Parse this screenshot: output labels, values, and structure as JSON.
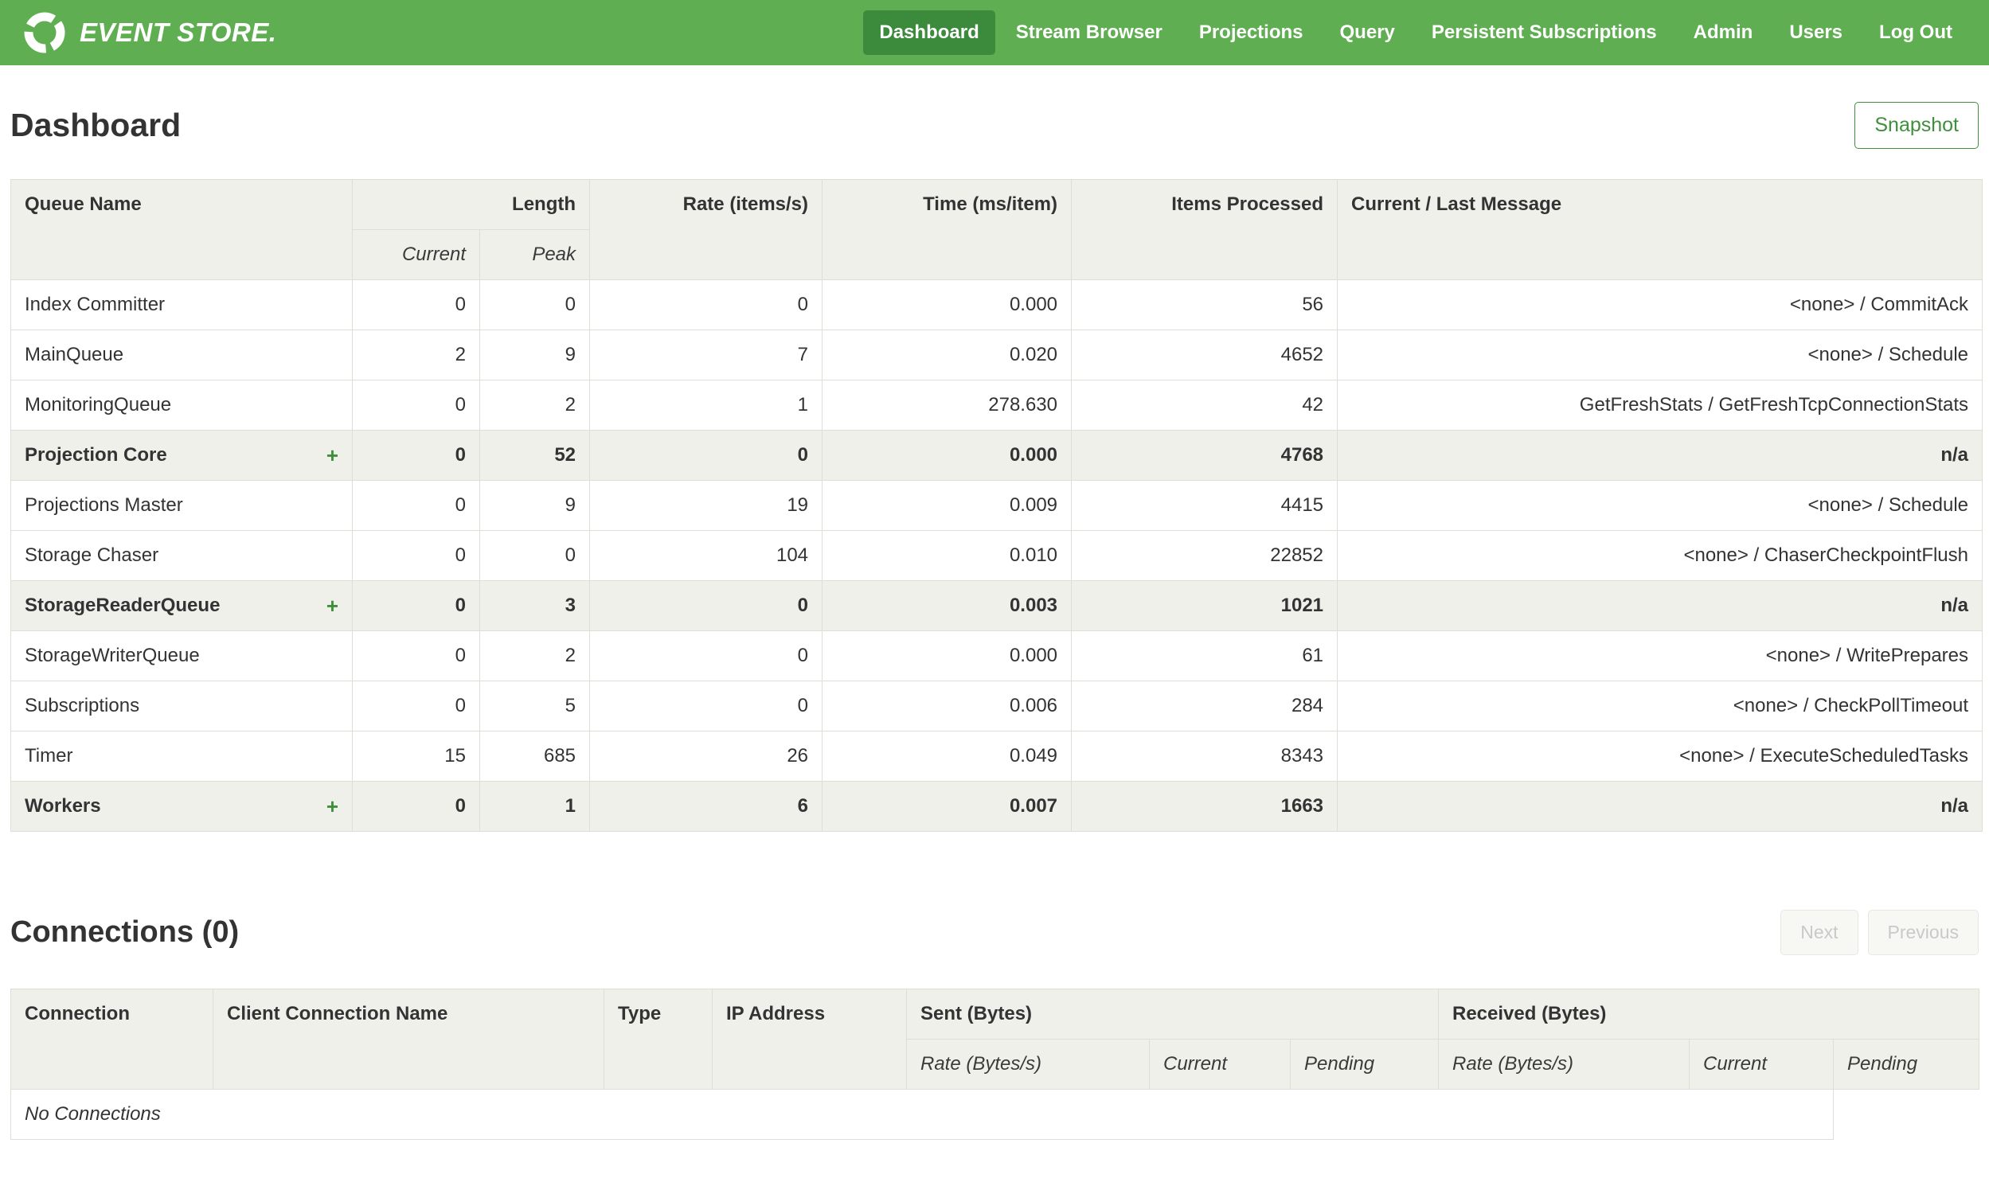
{
  "colors": {
    "navbar_green": "#5fae52",
    "active_item_green": "#3c8a3c",
    "accent_green": "#3f8f3d",
    "table_header_bg": "#f0f0ea"
  },
  "navbar": {
    "brand": "EVENT STORE.",
    "items": [
      {
        "label": "Dashboard",
        "active": true
      },
      {
        "label": "Stream Browser",
        "active": false
      },
      {
        "label": "Projections",
        "active": false
      },
      {
        "label": "Query",
        "active": false
      },
      {
        "label": "Persistent Subscriptions",
        "active": false
      },
      {
        "label": "Admin",
        "active": false
      },
      {
        "label": "Users",
        "active": false
      },
      {
        "label": "Log Out",
        "active": false
      }
    ]
  },
  "page": {
    "title": "Dashboard",
    "snapshot_button": "Snapshot"
  },
  "queues_table": {
    "headers": {
      "queue_name": "Queue Name",
      "length": "Length",
      "current": "Current",
      "peak": "Peak",
      "rate": "Rate (items/s)",
      "time": "Time (ms/item)",
      "items_processed": "Items Processed",
      "message": "Current / Last Message"
    },
    "expand_symbol": "+",
    "rows": [
      {
        "name": "Index Committer",
        "expandable": false,
        "current": "0",
        "peak": "0",
        "rate": "0",
        "time": "0.000",
        "items": "56",
        "message": "<none> / CommitAck"
      },
      {
        "name": "MainQueue",
        "expandable": false,
        "current": "2",
        "peak": "9",
        "rate": "7",
        "time": "0.020",
        "items": "4652",
        "message": "<none> / Schedule"
      },
      {
        "name": "MonitoringQueue",
        "expandable": false,
        "current": "0",
        "peak": "2",
        "rate": "1",
        "time": "278.630",
        "items": "42",
        "message": "GetFreshStats / GetFreshTcpConnectionStats"
      },
      {
        "name": "Projection Core",
        "expandable": true,
        "current": "0",
        "peak": "52",
        "rate": "0",
        "time": "0.000",
        "items": "4768",
        "message": "n/a"
      },
      {
        "name": "Projections Master",
        "expandable": false,
        "current": "0",
        "peak": "9",
        "rate": "19",
        "time": "0.009",
        "items": "4415",
        "message": "<none> / Schedule"
      },
      {
        "name": "Storage Chaser",
        "expandable": false,
        "current": "0",
        "peak": "0",
        "rate": "104",
        "time": "0.010",
        "items": "22852",
        "message": "<none> / ChaserCheckpointFlush"
      },
      {
        "name": "StorageReaderQueue",
        "expandable": true,
        "current": "0",
        "peak": "3",
        "rate": "0",
        "time": "0.003",
        "items": "1021",
        "message": "n/a"
      },
      {
        "name": "StorageWriterQueue",
        "expandable": false,
        "current": "0",
        "peak": "2",
        "rate": "0",
        "time": "0.000",
        "items": "61",
        "message": "<none> / WritePrepares"
      },
      {
        "name": "Subscriptions",
        "expandable": false,
        "current": "0",
        "peak": "5",
        "rate": "0",
        "time": "0.006",
        "items": "284",
        "message": "<none> / CheckPollTimeout"
      },
      {
        "name": "Timer",
        "expandable": false,
        "current": "15",
        "peak": "685",
        "rate": "26",
        "time": "0.049",
        "items": "8343",
        "message": "<none> / ExecuteScheduledTasks"
      },
      {
        "name": "Workers",
        "expandable": true,
        "current": "0",
        "peak": "1",
        "rate": "6",
        "time": "0.007",
        "items": "1663",
        "message": "n/a"
      }
    ]
  },
  "connections": {
    "title": "Connections (0)",
    "next_button": "Next",
    "previous_button": "Previous",
    "table": {
      "headers": {
        "connection": "Connection",
        "client_connection_name": "Client Connection Name",
        "type": "Type",
        "ip_address": "IP Address",
        "sent": "Sent (Bytes)",
        "received": "Received (Bytes)",
        "rate": "Rate (Bytes/s)",
        "current": "Current",
        "pending": "Pending"
      },
      "empty_message": "No Connections"
    }
  }
}
